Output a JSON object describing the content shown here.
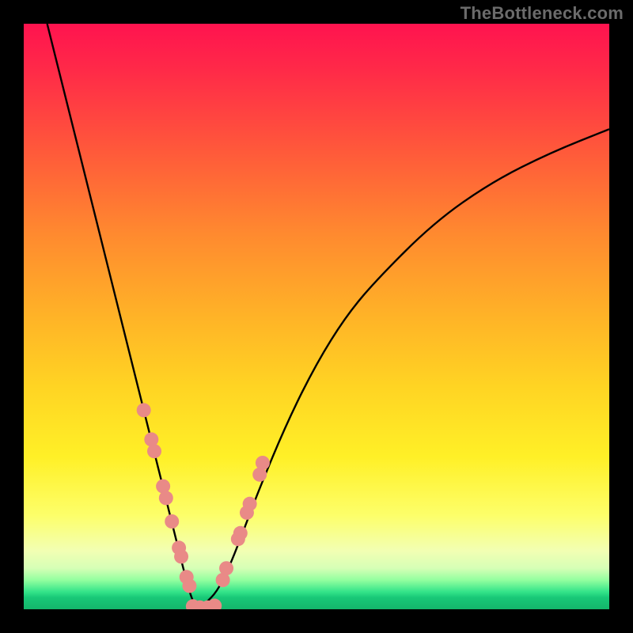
{
  "watermark": "TheBottleneck.com",
  "chart_data": {
    "type": "line",
    "title": "",
    "xlabel": "",
    "ylabel": "",
    "xlim": [
      0,
      100
    ],
    "ylim": [
      0,
      100
    ],
    "gradient_stops": [
      {
        "pos": 0,
        "color": "#ff134f"
      },
      {
        "pos": 22,
        "color": "#ff5a3a"
      },
      {
        "pos": 50,
        "color": "#ffb327"
      },
      {
        "pos": 74,
        "color": "#fff027"
      },
      {
        "pos": 90,
        "color": "#f2ffb3"
      },
      {
        "pos": 97,
        "color": "#34e48a"
      },
      {
        "pos": 100,
        "color": "#14b56b"
      }
    ],
    "series": [
      {
        "name": "bottleneck-curve",
        "description": "V-shaped bottleneck curve; y is mismatch percentage (100 at edges, 0 at optimum near x≈30), rendered as a black line",
        "x": [
          4,
          8,
          12,
          16,
          20,
          22,
          24,
          26,
          28,
          29,
          30,
          31,
          33,
          35,
          37,
          40,
          45,
          50,
          55,
          60,
          70,
          80,
          90,
          100
        ],
        "y": [
          100,
          84,
          68,
          52,
          36,
          28,
          20,
          12,
          4,
          1,
          0,
          1,
          3,
          7,
          12,
          20,
          32,
          42,
          50,
          56,
          66,
          73,
          78,
          82
        ]
      }
    ],
    "left_markers": {
      "name": "left-branch-dots",
      "color": "#e98a87",
      "description": "Pink circular markers on the lower part of the left branch; y is mismatch percentage",
      "x": [
        20.5,
        21.8,
        22.3,
        23.8,
        24.3,
        25.3,
        26.5,
        26.9,
        27.8,
        28.3
      ],
      "y": [
        34,
        29,
        27,
        21,
        19,
        15,
        10.5,
        9,
        5.5,
        4
      ]
    },
    "right_markers": {
      "name": "right-branch-dots",
      "color": "#e98a87",
      "description": "Pink circular markers on the lower part of the right branch; y is mismatch percentage",
      "x": [
        34.0,
        34.6,
        36.6,
        37.0,
        38.1,
        38.6,
        40.3,
        40.8
      ],
      "y": [
        5,
        7,
        12,
        13,
        16.5,
        18,
        23,
        25
      ]
    },
    "bottom_markers": {
      "name": "valley-dots",
      "color": "#e98a87",
      "description": "Pink circular markers sitting at the flat optimum (y ≈ 0)",
      "x": [
        28.9,
        30.1,
        31.4,
        32.6
      ],
      "y": [
        0.5,
        0.3,
        0.3,
        0.6
      ]
    }
  }
}
